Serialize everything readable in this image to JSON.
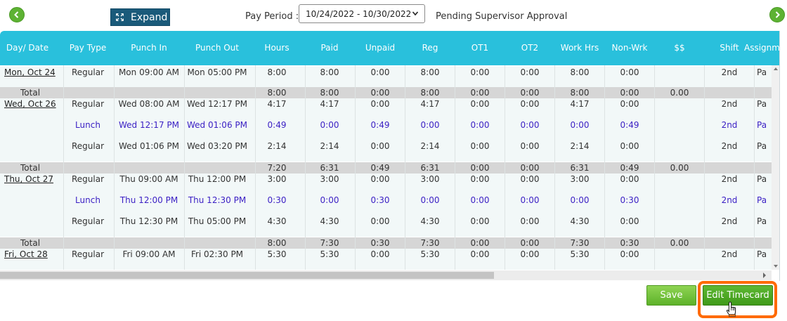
{
  "toolbar": {
    "expand_label": "Expand",
    "pay_period_label": "Pay Period :",
    "pay_period_value": "10/24/2022 - 10/30/2022",
    "status": "Pending Supervisor Approval"
  },
  "table": {
    "columns": [
      "Day/ Date",
      "Pay Type",
      "Punch In",
      "Punch Out",
      "Hours",
      "Paid",
      "Unpaid",
      "Reg",
      "OT1",
      "OT2",
      "Work Hrs",
      "Non-Wrk",
      "$$",
      "Shift",
      "Assignme"
    ],
    "rows": [
      {
        "kind": "detail",
        "date": "Mon, Oct 24",
        "type": "Regular",
        "in": "Mon 09:00 AM",
        "out": "Mon 05:00 PM",
        "hours": "8:00",
        "paid": "8:00",
        "unpaid": "0:00",
        "reg": "8:00",
        "ot1": "0:00",
        "ot2": "0:00",
        "work": "8:00",
        "nonwrk": "0:00",
        "money": "",
        "shift": "2nd",
        "assign": "Pa"
      },
      {
        "kind": "total",
        "date": "Total",
        "hours": "8:00",
        "paid": "8:00",
        "unpaid": "0:00",
        "reg": "8:00",
        "ot1": "0:00",
        "ot2": "0:00",
        "work": "8:00",
        "nonwrk": "0:00",
        "money": "0.00"
      },
      {
        "kind": "detail",
        "date": "Wed, Oct 26",
        "type": "Regular",
        "in": "Wed 08:00 AM",
        "out": "Wed 12:17 PM",
        "hours": "4:17",
        "paid": "4:17",
        "unpaid": "0:00",
        "reg": "4:17",
        "ot1": "0:00",
        "ot2": "0:00",
        "work": "4:17",
        "nonwrk": "0:00",
        "money": "",
        "shift": "2nd",
        "assign": "Pa"
      },
      {
        "kind": "lunch",
        "date": "",
        "type": "Lunch",
        "in": "Wed 12:17 PM",
        "out": "Wed 01:06 PM",
        "hours": "0:49",
        "paid": "0:00",
        "unpaid": "0:49",
        "reg": "0:00",
        "ot1": "0:00",
        "ot2": "0:00",
        "work": "0:00",
        "nonwrk": "0:49",
        "money": "",
        "shift": "2nd",
        "assign": "Pa"
      },
      {
        "kind": "detail",
        "date": "",
        "type": "Regular",
        "in": "Wed 01:06 PM",
        "out": "Wed 03:20 PM",
        "hours": "2:14",
        "paid": "2:14",
        "unpaid": "0:00",
        "reg": "2:14",
        "ot1": "0:00",
        "ot2": "0:00",
        "work": "2:14",
        "nonwrk": "0:00",
        "money": "",
        "shift": "2nd",
        "assign": "Pa"
      },
      {
        "kind": "total",
        "date": "Total",
        "hours": "7:20",
        "paid": "6:31",
        "unpaid": "0:49",
        "reg": "6:31",
        "ot1": "0:00",
        "ot2": "0:00",
        "work": "6:31",
        "nonwrk": "0:49",
        "money": "0.00"
      },
      {
        "kind": "detail",
        "date": "Thu, Oct 27",
        "type": "Regular",
        "in": "Thu 09:00 AM",
        "out": "Thu 12:00 PM",
        "hours": "3:00",
        "paid": "3:00",
        "unpaid": "0:00",
        "reg": "3:00",
        "ot1": "0:00",
        "ot2": "0:00",
        "work": "3:00",
        "nonwrk": "0:00",
        "money": "",
        "shift": "2nd",
        "assign": "Pa"
      },
      {
        "kind": "lunch",
        "date": "",
        "type": "Lunch",
        "in": "Thu 12:00 PM",
        "out": "Thu 12:30 PM",
        "hours": "0:30",
        "paid": "0:00",
        "unpaid": "0:30",
        "reg": "0:00",
        "ot1": "0:00",
        "ot2": "0:00",
        "work": "0:00",
        "nonwrk": "0:30",
        "money": "",
        "shift": "2nd",
        "assign": "Pa"
      },
      {
        "kind": "detail",
        "date": "",
        "type": "Regular",
        "in": "Thu 12:30 PM",
        "out": "Thu 05:00 PM",
        "hours": "4:30",
        "paid": "4:30",
        "unpaid": "0:00",
        "reg": "4:30",
        "ot1": "0:00",
        "ot2": "0:00",
        "work": "4:30",
        "nonwrk": "0:00",
        "money": "",
        "shift": "2nd",
        "assign": "Pa"
      },
      {
        "kind": "total",
        "date": "Total",
        "hours": "8:00",
        "paid": "7:30",
        "unpaid": "0:30",
        "reg": "7:30",
        "ot1": "0:00",
        "ot2": "0:00",
        "work": "7:30",
        "nonwrk": "0:30",
        "money": "0.00"
      },
      {
        "kind": "detail",
        "date": "Fri, Oct 28",
        "type": "Regular",
        "in": "Fri 09:00 AM",
        "out": "Fri 02:30 PM",
        "hours": "5:30",
        "paid": "5:30",
        "unpaid": "0:00",
        "reg": "5:30",
        "ot1": "0:00",
        "ot2": "0:00",
        "work": "5:30",
        "nonwrk": "0:00",
        "money": "",
        "shift": "2nd",
        "assign": "Pa"
      }
    ]
  },
  "actions": {
    "save_label": "Save",
    "edit_label": "Edit Timecard"
  },
  "colors": {
    "header": "#29c0dc",
    "lunch_text": "#3a1fc4",
    "accent_green": "#5db233",
    "highlight": "#ff6a00"
  }
}
